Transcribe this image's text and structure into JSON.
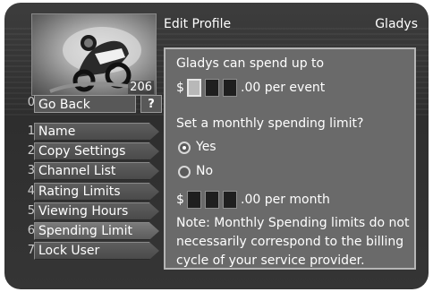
{
  "header": {
    "title": "Edit Profile",
    "user": "Gladys"
  },
  "preview": {
    "channel": "206",
    "icon": "motorcycle-racer-photo"
  },
  "goback": {
    "number": "0",
    "label": "Go Back",
    "help": "?"
  },
  "menu": [
    {
      "number": "1",
      "label": "Name"
    },
    {
      "number": "2",
      "label": "Copy Settings"
    },
    {
      "number": "3",
      "label": "Channel List"
    },
    {
      "number": "4",
      "label": "Rating Limits"
    },
    {
      "number": "5",
      "label": "Viewing Hours"
    },
    {
      "number": "6",
      "label": "Spending Limit"
    },
    {
      "number": "7",
      "label": "Lock User"
    }
  ],
  "panel": {
    "spend_prompt": "Gladys can spend up to",
    "currency": "$",
    "event_suffix": ".00 per event",
    "monthly_question": "Set a monthly spending limit?",
    "option_yes": "Yes",
    "option_no": "No",
    "month_suffix": ".00 per month",
    "note": "Note: Monthly Spending limits do not necessarily correspond to the billing cycle of your service provider."
  },
  "colors": {
    "panel": "#6a6a6a",
    "border": "#b5b5b5",
    "background": "#333333"
  }
}
